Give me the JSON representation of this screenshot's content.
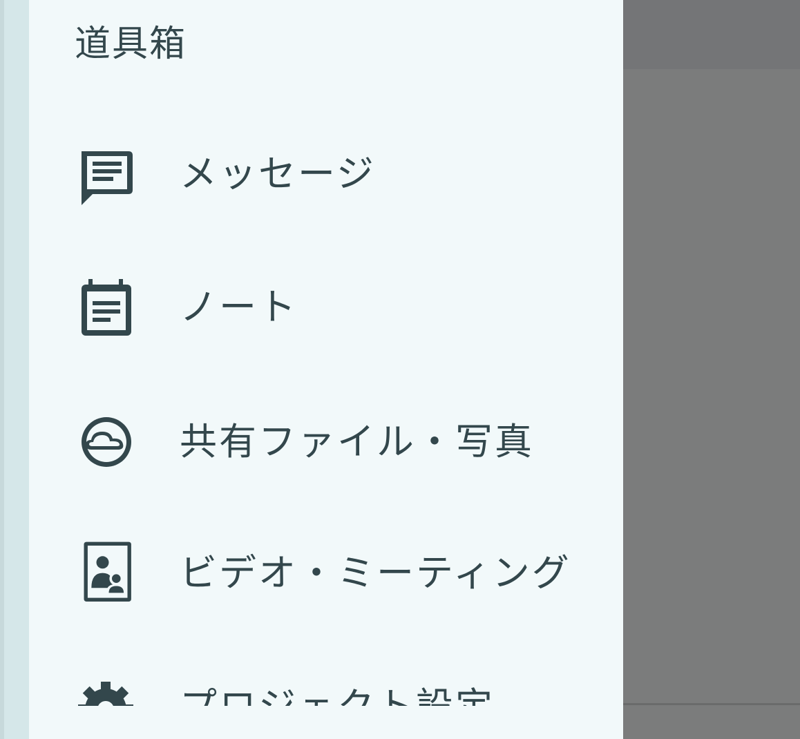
{
  "drawer": {
    "title": "道具箱",
    "items": [
      {
        "label": "メッセージ",
        "icon": "message-icon"
      },
      {
        "label": "ノート",
        "icon": "note-icon"
      },
      {
        "label": "共有ファイル・写真",
        "icon": "cloud-icon"
      },
      {
        "label": "ビデオ・ミーティング",
        "icon": "video-meeting-icon"
      },
      {
        "label": "プロジェクト設定",
        "icon": "gear-icon"
      }
    ]
  },
  "colors": {
    "drawer_background": "#f2f9fa",
    "text": "#33474c",
    "scrim": "#7b7c7c"
  }
}
